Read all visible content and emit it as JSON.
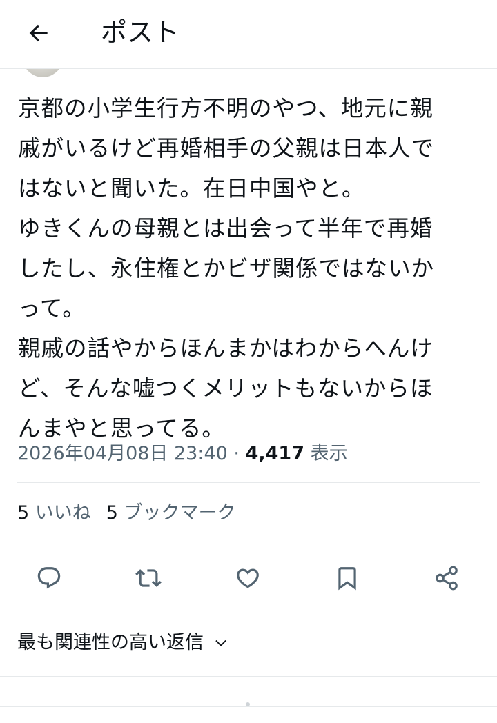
{
  "header": {
    "title": "ポスト",
    "back_icon": "arrow-left-icon"
  },
  "post": {
    "lines": [
      "京都の小学生行方不明のやつ、地元に親",
      "戚がいるけど再婚相手の父親は日本人で",
      "はないと聞いた。在日中国やと。",
      "ゆきくんの母親とは出会って半年で再婚",
      "したし、永住権とかビザ関係ではないか",
      "って。",
      "親戚の話やからほんまかはわからへんけ",
      "ど、そんな嘘つくメリットもないからほ",
      "んまやと思ってる。"
    ],
    "timestamp": "2026年04月08日 23:40",
    "separator": " · ",
    "views_count": "4,417",
    "views_label": "表示"
  },
  "stats": {
    "likes_count": "5",
    "likes_label": "いいね",
    "bookmarks_count": "5",
    "bookmarks_label": "ブックマーク"
  },
  "actions": [
    "reply-icon",
    "repost-icon",
    "like-icon",
    "bookmark-icon",
    "share-icon"
  ],
  "replies": {
    "sort_label": "最も関連性の高い返信",
    "sort_icon": "chevron-down-icon"
  },
  "colors": {
    "text": "#0f1419",
    "secondary": "#536471",
    "divider": "#e6e9eb"
  }
}
